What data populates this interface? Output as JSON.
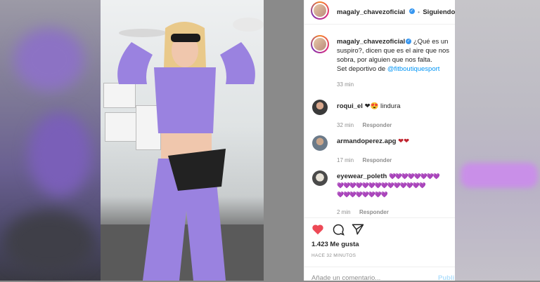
{
  "header": {
    "username": "magaly_chavezoficial",
    "separator": "•",
    "follow_status": "Siguiendo"
  },
  "caption": {
    "username": "magaly_chavezoficial",
    "line1": "¿Qué es un",
    "line2": "suspiro?, dicen que es el aire que nos",
    "line3": "sobra, por alguien que nos falta.",
    "line4_prefix": "Set deportivo de ",
    "mention": "@fitboutiquesport",
    "time": "33 min"
  },
  "comments": [
    {
      "username": "roqui_el",
      "text": "❤😍 lindura",
      "time": "32 min",
      "reply": "Responder"
    },
    {
      "username": "armandoperez.apg",
      "text": "❤❤",
      "time": "17 min",
      "reply": "Responder"
    },
    {
      "username": "eyewear_poleth",
      "line1": "💜💜💜💜💜💜💜💜",
      "line2": "💜💜💜💜💜💜💜💜💜💜💜💜💜💜",
      "line3": "💜💜💜💜💜💜💜💜",
      "time": "2 min",
      "reply": "Responder"
    }
  ],
  "likes": "1.423 Me gusta",
  "posted": "HACE 32 MINUTOS",
  "comment_box": {
    "placeholder": "Añade un comentario...",
    "publish": "Publi"
  },
  "colors": {
    "like_red": "#ed4956",
    "link_blue": "#0095f6",
    "heart_purple": "#a334fa"
  }
}
